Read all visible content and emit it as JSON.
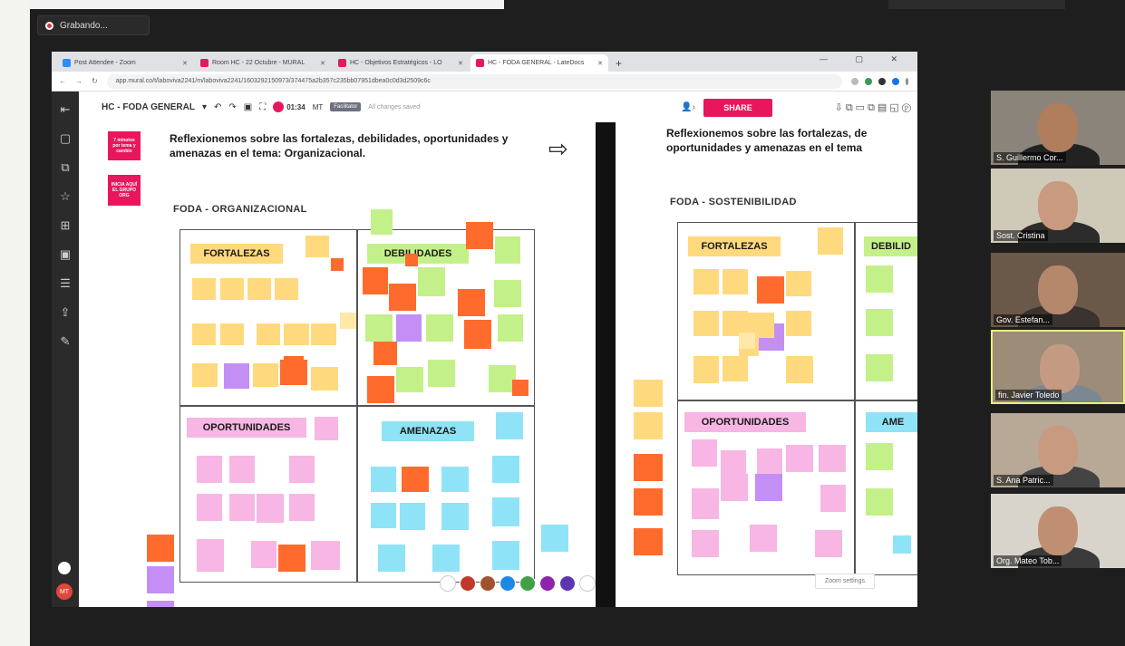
{
  "recording": {
    "label": "Grabando..."
  },
  "browser": {
    "tabs": [
      {
        "title": "Post Attendee - Zoom",
        "color": "#2d8cff"
      },
      {
        "title": "Room HC - 22 Octubre - MURAL",
        "color": "#e8175d"
      },
      {
        "title": "HC - Objetivos Estratégicos - LO",
        "color": "#e8175d"
      },
      {
        "title": "HC - FODA GENERAL - LateDocs",
        "color": "#e8175d"
      }
    ],
    "url": "app.mural.co/t/laboviva2241/m/laboviva2241/1603292150973/374475a2b357c235bb07951dbea0c0d3d2509c6c",
    "window_controls": "— ▢ ✕"
  },
  "app": {
    "mural_title": "HC - FODA GENERAL",
    "timer": "01:34",
    "initials": "MT",
    "facilitator": "Facilitator",
    "saved": "All changes saved",
    "share": "SHARE"
  },
  "canvas": {
    "pink_note_1": "7 minutos por tema y cambio",
    "pink_note_2": "INICIA AQUÍ EL GRUPO ORG",
    "heading_left": "Reflexionemos sobre las fortalezas, debilidades, oportunidades y amenazas en el tema: Organizacional.",
    "heading_right": "Reflexionemos sobre las fortalezas, de oportunidades y amenazas en el tema",
    "foda_left_title": "FODA - ORGANIZACIONAL",
    "foda_right_title": "FODA - SOSTENIBILIDAD",
    "quadrants": {
      "fortalezas": "FORTALEZAS",
      "debilidades": "DEBILIDADES",
      "debilidades_cut": "DEBILID",
      "oportunidades": "OPORTUNIDADES",
      "amenazas": "AMENAZAS",
      "amenazas_cut": "AME"
    },
    "zoom_settings": "Zoom settings",
    "bottom_avatar": "MT"
  },
  "participants": [
    {
      "name": "S. Guillermo Cor..."
    },
    {
      "name": "Sost. Cristina"
    },
    {
      "name": "Gov. Estefan..."
    },
    {
      "name": "fin. Javier Toledo"
    },
    {
      "name": "S. Ana Patric..."
    },
    {
      "name": "Org. Mateo Tob..."
    }
  ]
}
